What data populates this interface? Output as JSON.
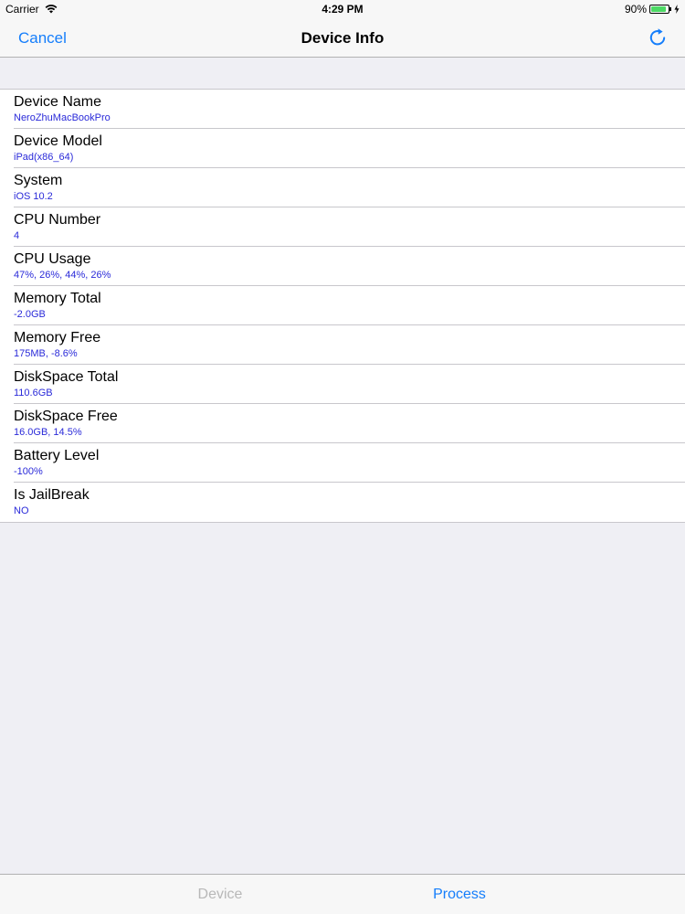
{
  "status_bar": {
    "carrier": "Carrier",
    "time": "4:29 PM",
    "battery": "90%",
    "wifi_icon": "wifi-icon",
    "battery_icon": "battery-icon",
    "charging_icon": "charging-bolt-icon",
    "battery_level": 0.9,
    "battery_color": "#4cd964"
  },
  "nav": {
    "cancel_label": "Cancel",
    "title": "Device Info",
    "refresh_icon": "refresh-icon",
    "accent_color": "#157efb"
  },
  "rows": [
    {
      "title": "Device Name",
      "value": "NeroZhuMacBookPro"
    },
    {
      "title": "Device Model",
      "value": "iPad(x86_64)"
    },
    {
      "title": "System",
      "value": "iOS 10.2"
    },
    {
      "title": "CPU Number",
      "value": "4"
    },
    {
      "title": "CPU Usage",
      "value": "47%, 26%, 44%, 26%"
    },
    {
      "title": "Memory Total",
      "value": "-2.0GB"
    },
    {
      "title": "Memory Free",
      "value": "175MB, -8.6%"
    },
    {
      "title": "DiskSpace Total",
      "value": "110.6GB"
    },
    {
      "title": "DiskSpace Free",
      "value": "16.0GB, 14.5%"
    },
    {
      "title": "Battery Level",
      "value": "-100%"
    },
    {
      "title": "Is JailBreak",
      "value": "NO"
    }
  ],
  "tabs": [
    {
      "label": "Device",
      "selected": false
    },
    {
      "label": "Process",
      "selected": true
    }
  ]
}
